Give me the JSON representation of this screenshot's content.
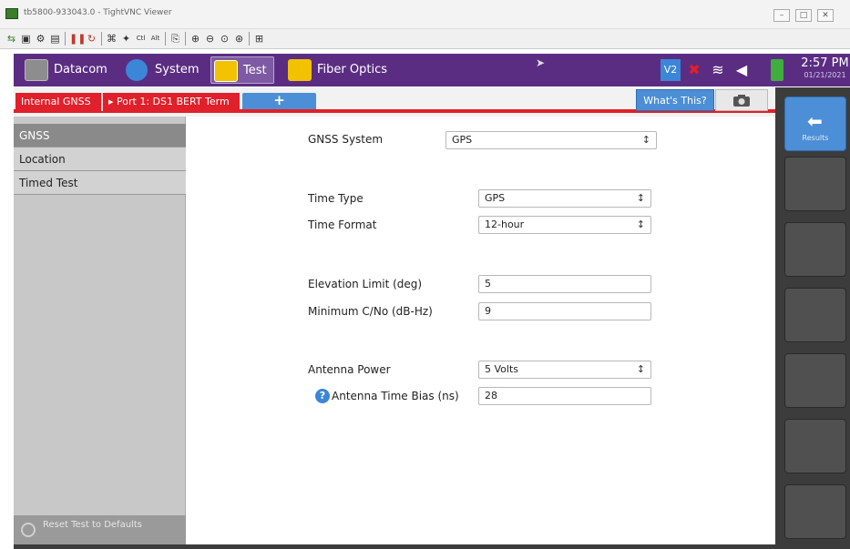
{
  "window": {
    "title": "tb5800-933043.0 - TightVNC Viewer",
    "minimize": "–",
    "maximize": "□",
    "close": "✕"
  },
  "nav": {
    "tabs": [
      {
        "label": "Datacom",
        "icon": "datacom-icon"
      },
      {
        "label": "System",
        "icon": "system-gear-icon"
      },
      {
        "label": "Test",
        "icon": "bert-test-icon"
      },
      {
        "label": "Fiber Optics",
        "icon": "fiber-optics-icon"
      }
    ],
    "active_tab": "Test",
    "v2_badge": "V2",
    "clock_time": "2:57 PM",
    "clock_date": "01/21/2021"
  },
  "tabrow": {
    "crumbs": [
      "Internal GNSS",
      "▸ Port 1: DS1 BERT Term"
    ],
    "add_label": "+",
    "whats_this": "What's This?"
  },
  "sidebar": {
    "items": [
      "GNSS",
      "Location",
      "Timed Test"
    ],
    "active": "GNSS",
    "reset_label": "Reset Test to Defaults"
  },
  "settings": {
    "gnss_system": {
      "label": "GNSS System",
      "value": "GPS"
    },
    "time_type": {
      "label": "Time Type",
      "value": "GPS"
    },
    "time_format": {
      "label": "Time Format",
      "value": "12-hour"
    },
    "elevation_limit": {
      "label": "Elevation Limit (deg)",
      "value": "5"
    },
    "minimum_cno": {
      "label": "Minimum C/No (dB-Hz)",
      "value": "9"
    },
    "antenna_power": {
      "label": "Antenna Power",
      "value": "5 Volts"
    },
    "antenna_time_bias": {
      "label": "Antenna Time Bias (ns)",
      "value": "28"
    }
  },
  "rightcol": {
    "back_label": "Results"
  },
  "colors": {
    "nav_bg": "#5a2d82",
    "crumb_red": "#e0202a",
    "accent_blue": "#4c8fd6",
    "sidebar_gray": "#c8c8c8"
  }
}
